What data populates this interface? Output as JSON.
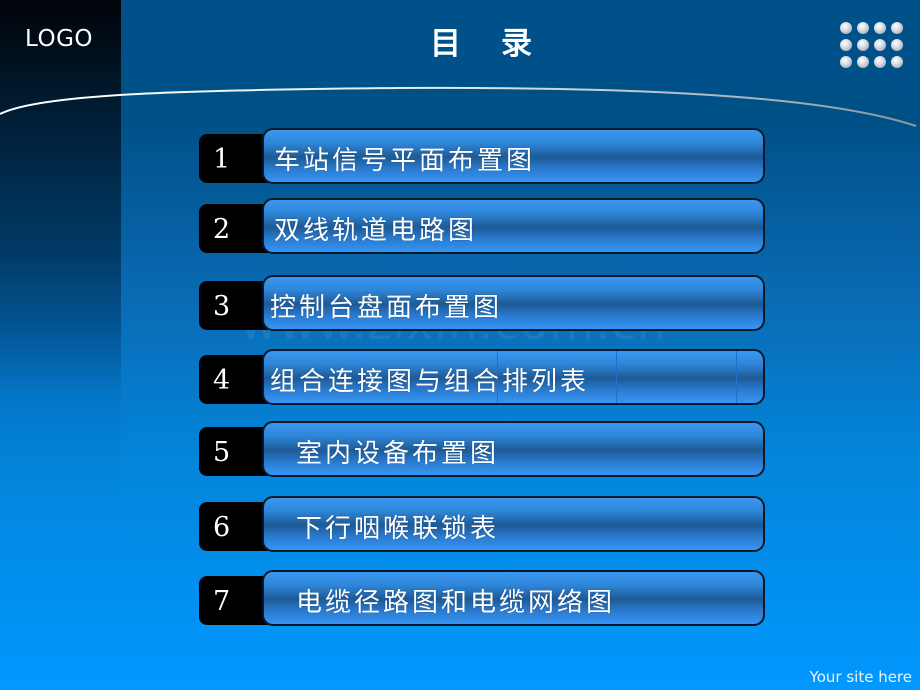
{
  "header": {
    "logo": "LOGO",
    "title": "目录"
  },
  "watermark": "www.zixin.com.cn",
  "toc": {
    "items": [
      {
        "number": "1",
        "label": "车站信号平面布置图"
      },
      {
        "number": "2",
        "label": "双线轨道电路图"
      },
      {
        "number": "3",
        "label": "控制台盘面布置图"
      },
      {
        "number": "4",
        "label": "组合连接图与组合排列表"
      },
      {
        "number": "5",
        "label": "室内设备布置图"
      },
      {
        "number": "6",
        "label": "下行咽喉联锁表"
      },
      {
        "number": "7",
        "label": "电缆径路图和电缆网络图"
      }
    ]
  },
  "footer": {
    "site": "Your site here"
  },
  "colors": {
    "background_top": "#00508a",
    "background_bottom": "#0298ff",
    "bar_light": "#3a97f0",
    "bar_dark": "#1d5a96",
    "number_tab": "#000000",
    "text": "#ffffff"
  }
}
